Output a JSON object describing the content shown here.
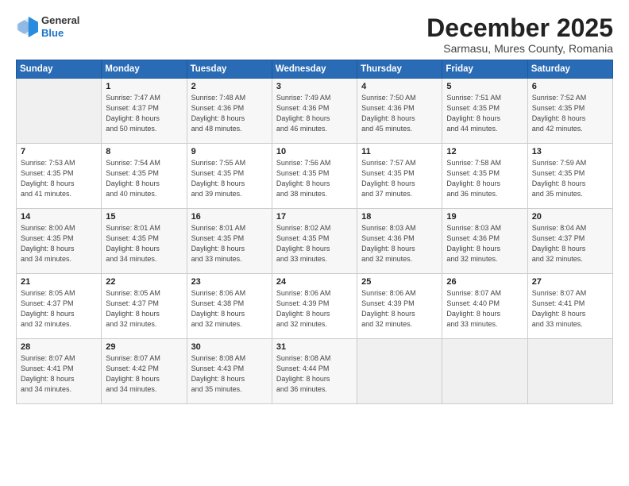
{
  "logo": {
    "line1": "General",
    "line2": "Blue"
  },
  "title": "December 2025",
  "subtitle": "Sarmasu, Mures County, Romania",
  "header_days": [
    "Sunday",
    "Monday",
    "Tuesday",
    "Wednesday",
    "Thursday",
    "Friday",
    "Saturday"
  ],
  "weeks": [
    [
      {
        "day": "",
        "content": ""
      },
      {
        "day": "1",
        "content": "Sunrise: 7:47 AM\nSunset: 4:37 PM\nDaylight: 8 hours\nand 50 minutes."
      },
      {
        "day": "2",
        "content": "Sunrise: 7:48 AM\nSunset: 4:36 PM\nDaylight: 8 hours\nand 48 minutes."
      },
      {
        "day": "3",
        "content": "Sunrise: 7:49 AM\nSunset: 4:36 PM\nDaylight: 8 hours\nand 46 minutes."
      },
      {
        "day": "4",
        "content": "Sunrise: 7:50 AM\nSunset: 4:36 PM\nDaylight: 8 hours\nand 45 minutes."
      },
      {
        "day": "5",
        "content": "Sunrise: 7:51 AM\nSunset: 4:35 PM\nDaylight: 8 hours\nand 44 minutes."
      },
      {
        "day": "6",
        "content": "Sunrise: 7:52 AM\nSunset: 4:35 PM\nDaylight: 8 hours\nand 42 minutes."
      }
    ],
    [
      {
        "day": "7",
        "content": "Sunrise: 7:53 AM\nSunset: 4:35 PM\nDaylight: 8 hours\nand 41 minutes."
      },
      {
        "day": "8",
        "content": "Sunrise: 7:54 AM\nSunset: 4:35 PM\nDaylight: 8 hours\nand 40 minutes."
      },
      {
        "day": "9",
        "content": "Sunrise: 7:55 AM\nSunset: 4:35 PM\nDaylight: 8 hours\nand 39 minutes."
      },
      {
        "day": "10",
        "content": "Sunrise: 7:56 AM\nSunset: 4:35 PM\nDaylight: 8 hours\nand 38 minutes."
      },
      {
        "day": "11",
        "content": "Sunrise: 7:57 AM\nSunset: 4:35 PM\nDaylight: 8 hours\nand 37 minutes."
      },
      {
        "day": "12",
        "content": "Sunrise: 7:58 AM\nSunset: 4:35 PM\nDaylight: 8 hours\nand 36 minutes."
      },
      {
        "day": "13",
        "content": "Sunrise: 7:59 AM\nSunset: 4:35 PM\nDaylight: 8 hours\nand 35 minutes."
      }
    ],
    [
      {
        "day": "14",
        "content": "Sunrise: 8:00 AM\nSunset: 4:35 PM\nDaylight: 8 hours\nand 34 minutes."
      },
      {
        "day": "15",
        "content": "Sunrise: 8:01 AM\nSunset: 4:35 PM\nDaylight: 8 hours\nand 34 minutes."
      },
      {
        "day": "16",
        "content": "Sunrise: 8:01 AM\nSunset: 4:35 PM\nDaylight: 8 hours\nand 33 minutes."
      },
      {
        "day": "17",
        "content": "Sunrise: 8:02 AM\nSunset: 4:35 PM\nDaylight: 8 hours\nand 33 minutes."
      },
      {
        "day": "18",
        "content": "Sunrise: 8:03 AM\nSunset: 4:36 PM\nDaylight: 8 hours\nand 32 minutes."
      },
      {
        "day": "19",
        "content": "Sunrise: 8:03 AM\nSunset: 4:36 PM\nDaylight: 8 hours\nand 32 minutes."
      },
      {
        "day": "20",
        "content": "Sunrise: 8:04 AM\nSunset: 4:37 PM\nDaylight: 8 hours\nand 32 minutes."
      }
    ],
    [
      {
        "day": "21",
        "content": "Sunrise: 8:05 AM\nSunset: 4:37 PM\nDaylight: 8 hours\nand 32 minutes."
      },
      {
        "day": "22",
        "content": "Sunrise: 8:05 AM\nSunset: 4:37 PM\nDaylight: 8 hours\nand 32 minutes."
      },
      {
        "day": "23",
        "content": "Sunrise: 8:06 AM\nSunset: 4:38 PM\nDaylight: 8 hours\nand 32 minutes."
      },
      {
        "day": "24",
        "content": "Sunrise: 8:06 AM\nSunset: 4:39 PM\nDaylight: 8 hours\nand 32 minutes."
      },
      {
        "day": "25",
        "content": "Sunrise: 8:06 AM\nSunset: 4:39 PM\nDaylight: 8 hours\nand 32 minutes."
      },
      {
        "day": "26",
        "content": "Sunrise: 8:07 AM\nSunset: 4:40 PM\nDaylight: 8 hours\nand 33 minutes."
      },
      {
        "day": "27",
        "content": "Sunrise: 8:07 AM\nSunset: 4:41 PM\nDaylight: 8 hours\nand 33 minutes."
      }
    ],
    [
      {
        "day": "28",
        "content": "Sunrise: 8:07 AM\nSunset: 4:41 PM\nDaylight: 8 hours\nand 34 minutes."
      },
      {
        "day": "29",
        "content": "Sunrise: 8:07 AM\nSunset: 4:42 PM\nDaylight: 8 hours\nand 34 minutes."
      },
      {
        "day": "30",
        "content": "Sunrise: 8:08 AM\nSunset: 4:43 PM\nDaylight: 8 hours\nand 35 minutes."
      },
      {
        "day": "31",
        "content": "Sunrise: 8:08 AM\nSunset: 4:44 PM\nDaylight: 8 hours\nand 36 minutes."
      },
      {
        "day": "",
        "content": ""
      },
      {
        "day": "",
        "content": ""
      },
      {
        "day": "",
        "content": ""
      }
    ]
  ]
}
